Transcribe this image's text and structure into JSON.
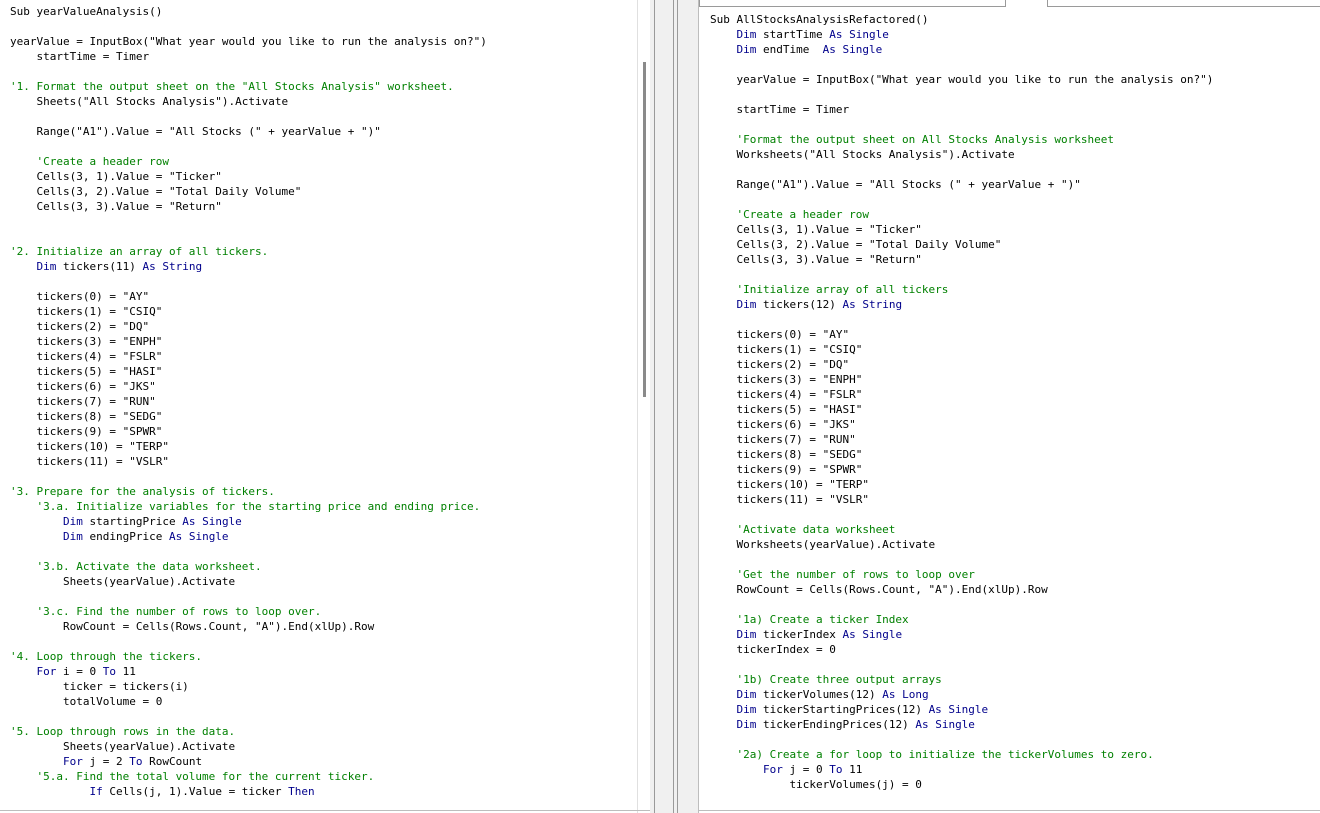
{
  "colors": {
    "keyword": "#00008b",
    "comment": "#008000",
    "text": "#000000"
  },
  "left_code": [
    [
      [
        "t",
        "Sub yearValueAnalysis()"
      ]
    ],
    [],
    [
      [
        "t",
        "yearValue = InputBox(\"What year would you like to run the analysis on?\")"
      ]
    ],
    [
      [
        "t",
        "    startTime = Timer"
      ]
    ],
    [],
    [
      [
        "c",
        "'1. Format the output sheet on the \"All Stocks Analysis\" worksheet."
      ]
    ],
    [
      [
        "t",
        "    Sheets(\"All Stocks Analysis\").Activate"
      ]
    ],
    [],
    [
      [
        "t",
        "    Range(\"A1\").Value = \"All Stocks (\" + yearValue + \")\""
      ]
    ],
    [],
    [
      [
        "c",
        "    'Create a header row"
      ]
    ],
    [
      [
        "t",
        "    Cells(3, 1).Value = \"Ticker\""
      ]
    ],
    [
      [
        "t",
        "    Cells(3, 2).Value = \"Total Daily Volume\""
      ]
    ],
    [
      [
        "t",
        "    Cells(3, 3).Value = \"Return\""
      ]
    ],
    [],
    [],
    [
      [
        "c",
        "'2. Initialize an array of all tickers."
      ]
    ],
    [
      [
        "t",
        "    "
      ],
      [
        "k",
        "Dim"
      ],
      [
        "t",
        " tickers(11) "
      ],
      [
        "k",
        "As String"
      ]
    ],
    [],
    [
      [
        "t",
        "    tickers(0) = \"AY\""
      ]
    ],
    [
      [
        "t",
        "    tickers(1) = \"CSIQ\""
      ]
    ],
    [
      [
        "t",
        "    tickers(2) = \"DQ\""
      ]
    ],
    [
      [
        "t",
        "    tickers(3) = \"ENPH\""
      ]
    ],
    [
      [
        "t",
        "    tickers(4) = \"FSLR\""
      ]
    ],
    [
      [
        "t",
        "    tickers(5) = \"HASI\""
      ]
    ],
    [
      [
        "t",
        "    tickers(6) = \"JKS\""
      ]
    ],
    [
      [
        "t",
        "    tickers(7) = \"RUN\""
      ]
    ],
    [
      [
        "t",
        "    tickers(8) = \"SEDG\""
      ]
    ],
    [
      [
        "t",
        "    tickers(9) = \"SPWR\""
      ]
    ],
    [
      [
        "t",
        "    tickers(10) = \"TERP\""
      ]
    ],
    [
      [
        "t",
        "    tickers(11) = \"VSLR\""
      ]
    ],
    [],
    [
      [
        "c",
        "'3. Prepare for the analysis of tickers."
      ]
    ],
    [
      [
        "c",
        "    '3.a. Initialize variables for the starting price and ending price."
      ]
    ],
    [
      [
        "t",
        "        "
      ],
      [
        "k",
        "Dim"
      ],
      [
        "t",
        " startingPrice "
      ],
      [
        "k",
        "As Single"
      ]
    ],
    [
      [
        "t",
        "        "
      ],
      [
        "k",
        "Dim"
      ],
      [
        "t",
        " endingPrice "
      ],
      [
        "k",
        "As Single"
      ]
    ],
    [],
    [
      [
        "c",
        "    '3.b. Activate the data worksheet."
      ]
    ],
    [
      [
        "t",
        "        Sheets(yearValue).Activate"
      ]
    ],
    [],
    [
      [
        "c",
        "    '3.c. Find the number of rows to loop over."
      ]
    ],
    [
      [
        "t",
        "        RowCount = Cells(Rows.Count, \"A\").End(xlUp).Row"
      ]
    ],
    [],
    [
      [
        "c",
        "'4. Loop through the tickers."
      ]
    ],
    [
      [
        "t",
        "    "
      ],
      [
        "k",
        "For"
      ],
      [
        "t",
        " i = 0 "
      ],
      [
        "k",
        "To"
      ],
      [
        "t",
        " 11"
      ]
    ],
    [
      [
        "t",
        "        ticker = tickers(i)"
      ]
    ],
    [
      [
        "t",
        "        totalVolume = 0"
      ]
    ],
    [],
    [
      [
        "c",
        "'5. Loop through rows in the data."
      ]
    ],
    [
      [
        "t",
        "        Sheets(yearValue).Activate"
      ]
    ],
    [
      [
        "t",
        "        "
      ],
      [
        "k",
        "For"
      ],
      [
        "t",
        " j = 2 "
      ],
      [
        "k",
        "To"
      ],
      [
        "t",
        " RowCount"
      ]
    ],
    [
      [
        "c",
        "    '5.a. Find the total volume for the current ticker."
      ]
    ],
    [
      [
        "t",
        "            "
      ],
      [
        "k",
        "If"
      ],
      [
        "t",
        " Cells(j, 1).Value = ticker "
      ],
      [
        "k",
        "Then"
      ]
    ]
  ],
  "right_code": [
    [
      [
        "t",
        "Sub AllStocksAnalysisRefactored()"
      ]
    ],
    [
      [
        "t",
        "    "
      ],
      [
        "k",
        "Dim"
      ],
      [
        "t",
        " startTime "
      ],
      [
        "k",
        "As Single"
      ]
    ],
    [
      [
        "t",
        "    "
      ],
      [
        "k",
        "Dim"
      ],
      [
        "t",
        " endTime  "
      ],
      [
        "k",
        "As Single"
      ]
    ],
    [],
    [
      [
        "t",
        "    yearValue = InputBox(\"What year would you like to run the analysis on?\")"
      ]
    ],
    [],
    [
      [
        "t",
        "    startTime = Timer"
      ]
    ],
    [],
    [
      [
        "c",
        "    'Format the output sheet on All Stocks Analysis worksheet"
      ]
    ],
    [
      [
        "t",
        "    Worksheets(\"All Stocks Analysis\").Activate"
      ]
    ],
    [],
    [
      [
        "t",
        "    Range(\"A1\").Value = \"All Stocks (\" + yearValue + \")\""
      ]
    ],
    [],
    [
      [
        "c",
        "    'Create a header row"
      ]
    ],
    [
      [
        "t",
        "    Cells(3, 1).Value = \"Ticker\""
      ]
    ],
    [
      [
        "t",
        "    Cells(3, 2).Value = \"Total Daily Volume\""
      ]
    ],
    [
      [
        "t",
        "    Cells(3, 3).Value = \"Return\""
      ]
    ],
    [],
    [
      [
        "c",
        "    'Initialize array of all tickers"
      ]
    ],
    [
      [
        "t",
        "    "
      ],
      [
        "k",
        "Dim"
      ],
      [
        "t",
        " tickers(12) "
      ],
      [
        "k",
        "As String"
      ]
    ],
    [],
    [
      [
        "t",
        "    tickers(0) = \"AY\""
      ]
    ],
    [
      [
        "t",
        "    tickers(1) = \"CSIQ\""
      ]
    ],
    [
      [
        "t",
        "    tickers(2) = \"DQ\""
      ]
    ],
    [
      [
        "t",
        "    tickers(3) = \"ENPH\""
      ]
    ],
    [
      [
        "t",
        "    tickers(4) = \"FSLR\""
      ]
    ],
    [
      [
        "t",
        "    tickers(5) = \"HASI\""
      ]
    ],
    [
      [
        "t",
        "    tickers(6) = \"JKS\""
      ]
    ],
    [
      [
        "t",
        "    tickers(7) = \"RUN\""
      ]
    ],
    [
      [
        "t",
        "    tickers(8) = \"SEDG\""
      ]
    ],
    [
      [
        "t",
        "    tickers(9) = \"SPWR\""
      ]
    ],
    [
      [
        "t",
        "    tickers(10) = \"TERP\""
      ]
    ],
    [
      [
        "t",
        "    tickers(11) = \"VSLR\""
      ]
    ],
    [],
    [
      [
        "c",
        "    'Activate data worksheet"
      ]
    ],
    [
      [
        "t",
        "    Worksheets(yearValue).Activate"
      ]
    ],
    [],
    [
      [
        "c",
        "    'Get the number of rows to loop over"
      ]
    ],
    [
      [
        "t",
        "    RowCount = Cells(Rows.Count, \"A\").End(xlUp).Row"
      ]
    ],
    [],
    [
      [
        "c",
        "    '1a) Create a ticker Index"
      ]
    ],
    [
      [
        "t",
        "    "
      ],
      [
        "k",
        "Dim"
      ],
      [
        "t",
        " tickerIndex "
      ],
      [
        "k",
        "As Single"
      ]
    ],
    [
      [
        "t",
        "    tickerIndex = 0"
      ]
    ],
    [],
    [
      [
        "c",
        "    '1b) Create three output arrays"
      ]
    ],
    [
      [
        "t",
        "    "
      ],
      [
        "k",
        "Dim"
      ],
      [
        "t",
        " tickerVolumes(12) "
      ],
      [
        "k",
        "As Long"
      ]
    ],
    [
      [
        "t",
        "    "
      ],
      [
        "k",
        "Dim"
      ],
      [
        "t",
        " tickerStartingPrices(12) "
      ],
      [
        "k",
        "As Single"
      ]
    ],
    [
      [
        "t",
        "    "
      ],
      [
        "k",
        "Dim"
      ],
      [
        "t",
        " tickerEndingPrices(12) "
      ],
      [
        "k",
        "As Single"
      ]
    ],
    [],
    [
      [
        "c",
        "    '2a) Create a for loop to initialize the tickerVolumes to zero."
      ]
    ],
    [
      [
        "t",
        "        "
      ],
      [
        "k",
        "For"
      ],
      [
        "t",
        " j = 0 "
      ],
      [
        "k",
        "To"
      ],
      [
        "t",
        " 11"
      ]
    ],
    [
      [
        "t",
        "            tickerVolumes(j) = 0"
      ]
    ]
  ]
}
